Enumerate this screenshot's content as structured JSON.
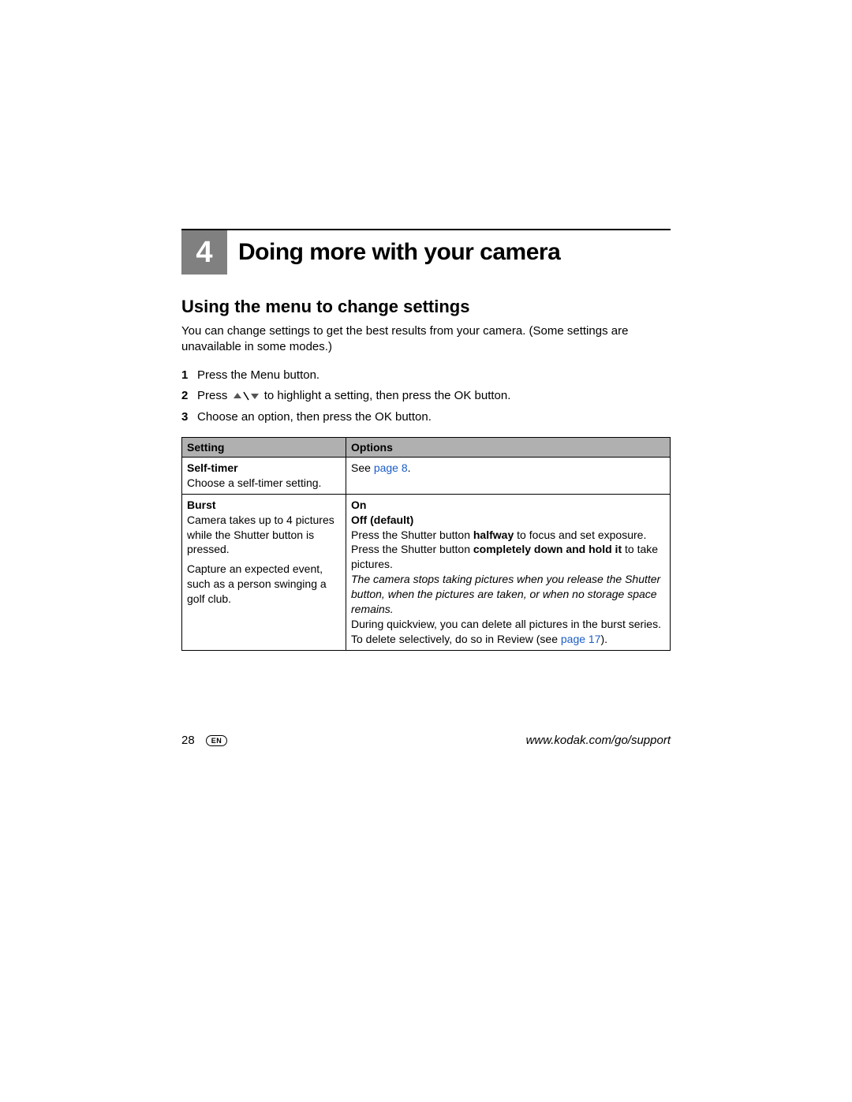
{
  "chapter": {
    "number": "4",
    "title": "Doing more with your camera"
  },
  "section": {
    "title": "Using the menu to change settings",
    "intro": "You can change settings to get the best results from your camera. (Some settings are unavailable in some modes.)",
    "steps": {
      "s1": "Press the Menu button.",
      "s2a": "Press ",
      "s2b": " to highlight a setting, then press the OK button.",
      "s3": "Choose an option, then press the OK button."
    }
  },
  "table": {
    "headers": {
      "setting": "Setting",
      "options": "Options"
    },
    "row1": {
      "name": "Self-timer",
      "desc": "Choose a self-timer setting.",
      "opt_prefix": "See ",
      "opt_link": "page 8",
      "opt_suffix": "."
    },
    "row2": {
      "name": "Burst",
      "desc1": "Camera takes up to 4 pictures while the Shutter button is pressed.",
      "desc2": "Capture an expected event, such as a person swinging a golf club.",
      "opt_on": "On",
      "opt_off": "Off (default)",
      "p1a": "Press the Shutter button ",
      "p1b": "halfway",
      "p1c": " to focus and set exposure. Press the Shutter button ",
      "p1d": "completely down and hold it",
      "p1e": " to take pictures.",
      "p2": "The camera stops taking pictures when you release the Shutter button, when the pictures are taken, or when no storage space remains.",
      "p3a": "During quickview, you can delete all pictures in the burst series. To delete selectively, do so in Review (see ",
      "p3b": "page 17",
      "p3c": ")."
    }
  },
  "footer": {
    "page": "28",
    "lang": "EN",
    "url": "www.kodak.com/go/support"
  }
}
